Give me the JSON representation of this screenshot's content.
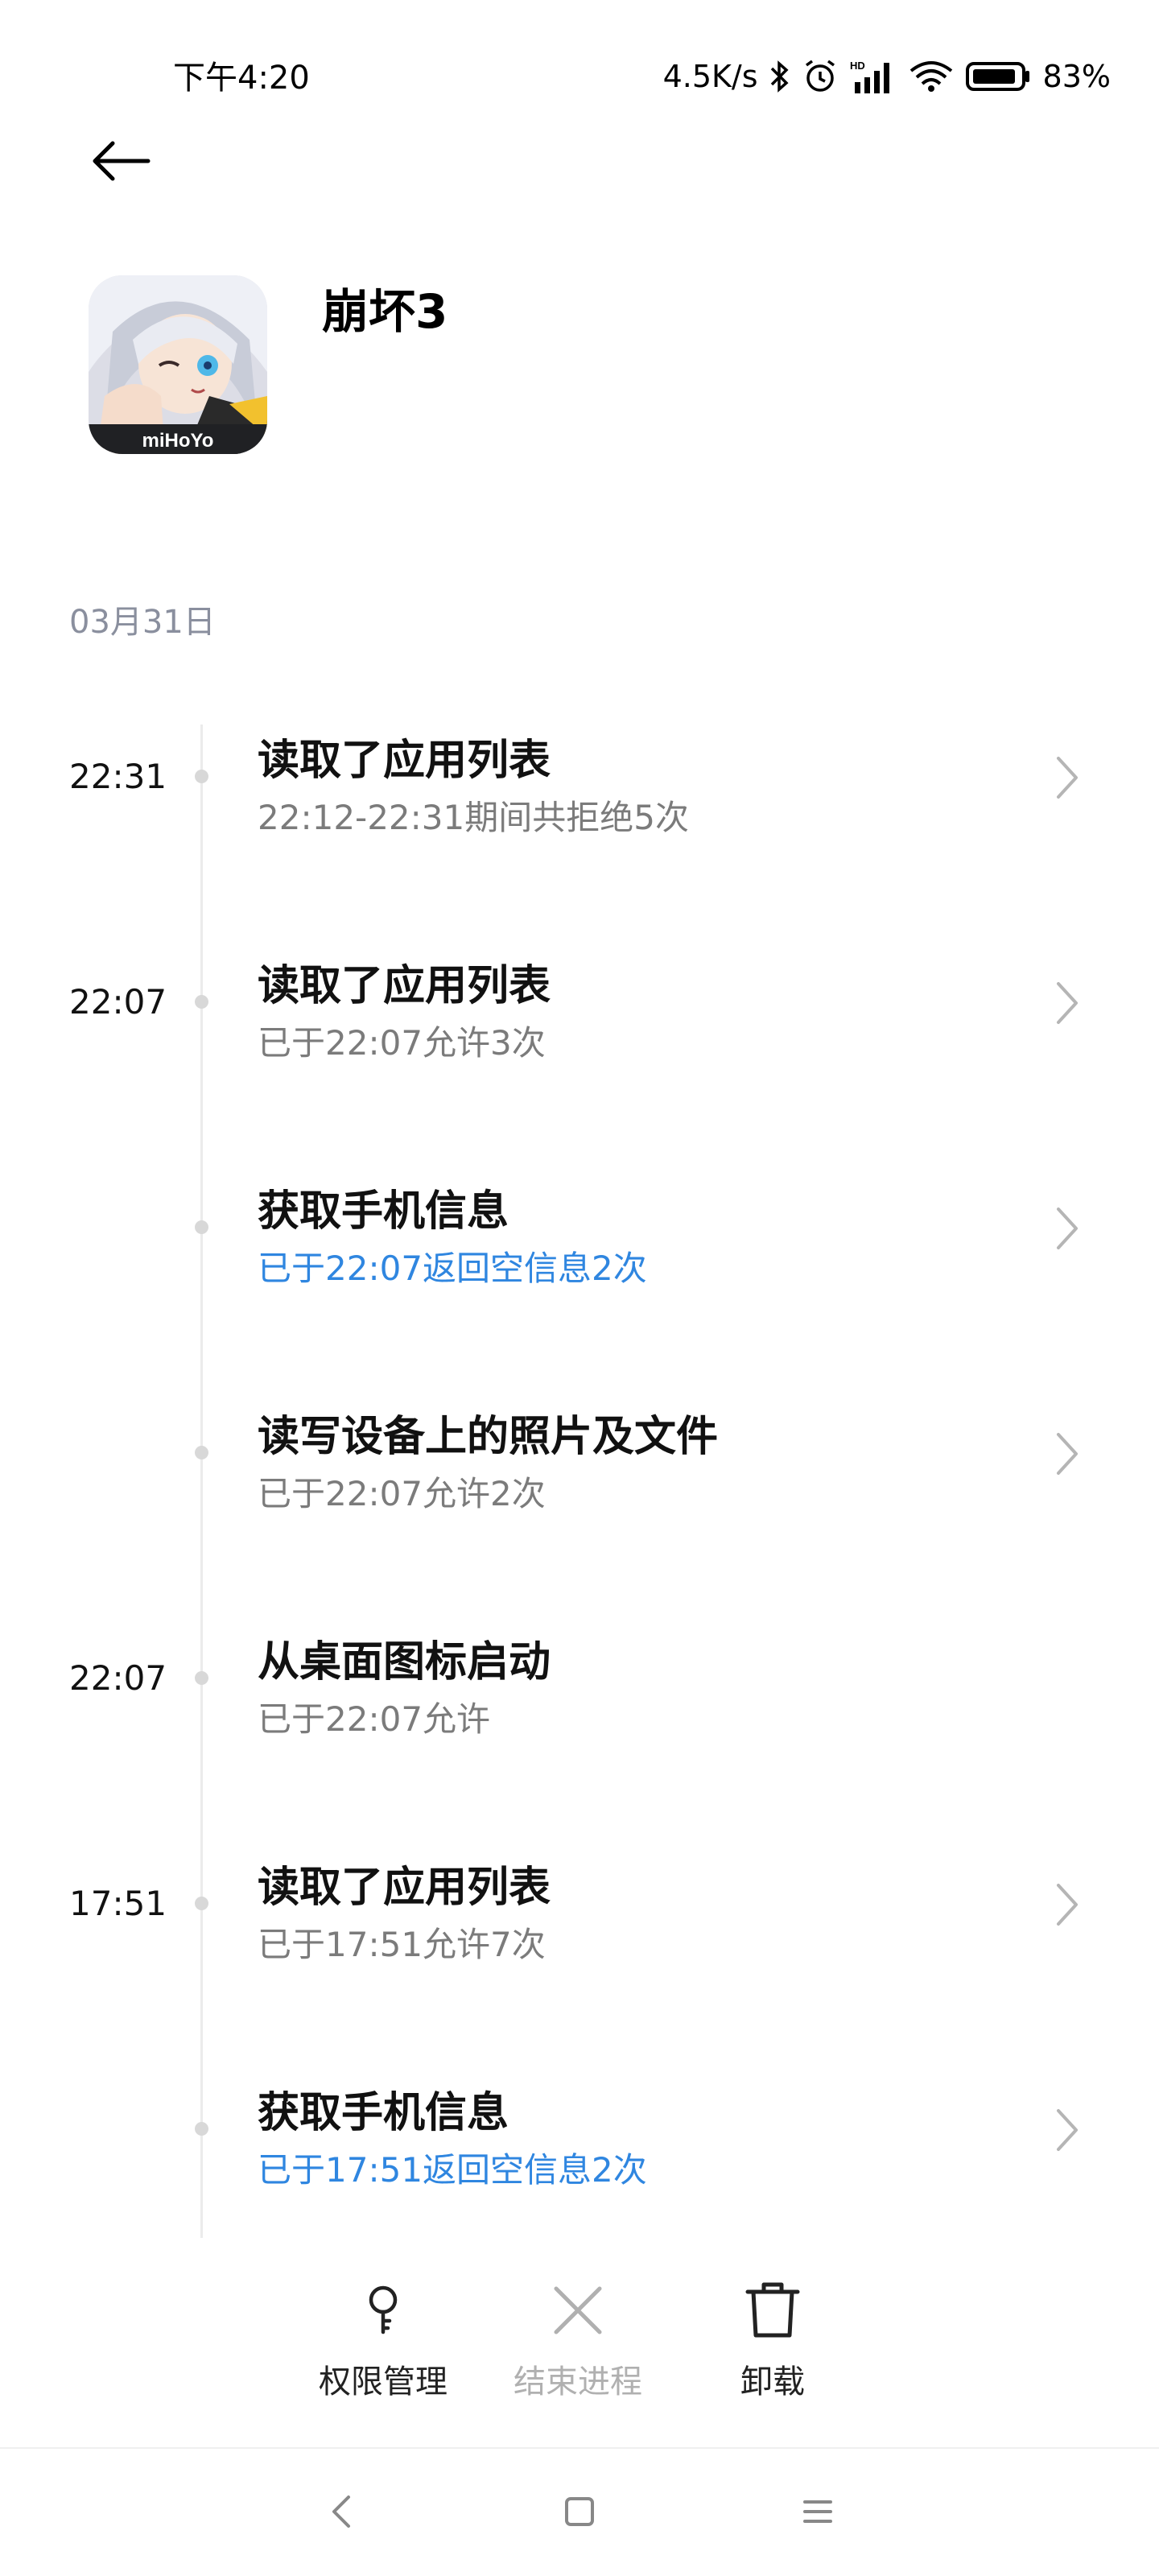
{
  "status_bar": {
    "time": "下午4:20",
    "net_speed": "4.5K/s",
    "battery": "83%",
    "icons": [
      "bluetooth-icon",
      "alarm-icon",
      "hd-signal-icon",
      "wifi-icon",
      "battery-icon"
    ]
  },
  "header": {
    "back_icon": "arrow-left-icon",
    "app_name": "崩坏3",
    "app_icon_text": "miHoYo"
  },
  "date": "03月31日",
  "timeline": [
    {
      "time": "22:31",
      "title": "读取了应用列表",
      "subtitle": "22:12-22:31期间共拒绝5次",
      "subtitle_color": "gray",
      "has_chevron": true
    },
    {
      "time": "22:07",
      "title": "读取了应用列表",
      "subtitle": "已于22:07允许3次",
      "subtitle_color": "gray",
      "has_chevron": true
    },
    {
      "time": "",
      "title": "获取手机信息",
      "subtitle": "已于22:07返回空信息2次",
      "subtitle_color": "blue",
      "has_chevron": true
    },
    {
      "time": "",
      "title": "读写设备上的照片及文件",
      "subtitle": "已于22:07允许2次",
      "subtitle_color": "gray",
      "has_chevron": true
    },
    {
      "time": "22:07",
      "title": "从桌面图标启动",
      "subtitle": "已于22:07允许",
      "subtitle_color": "gray",
      "has_chevron": false
    },
    {
      "time": "17:51",
      "title": "读取了应用列表",
      "subtitle": "已于17:51允许7次",
      "subtitle_color": "gray",
      "has_chevron": true
    },
    {
      "time": "",
      "title": "获取手机信息",
      "subtitle": "已于17:51返回空信息2次",
      "subtitle_color": "blue",
      "has_chevron": true
    }
  ],
  "actions": [
    {
      "label": "权限管理",
      "icon": "key-icon",
      "enabled": true
    },
    {
      "label": "结束进程",
      "icon": "close-icon",
      "enabled": false
    },
    {
      "label": "卸载",
      "icon": "trash-icon",
      "enabled": true
    }
  ],
  "nav": {
    "back": "nav-back-icon",
    "home": "nav-home-icon",
    "recents": "nav-menu-icon"
  },
  "colors": {
    "accent_blue": "#2f86e0",
    "muted_gray": "#7b7b7b",
    "date_gray": "#8a8f9e",
    "disabled_gray": "#b0b0b0"
  }
}
